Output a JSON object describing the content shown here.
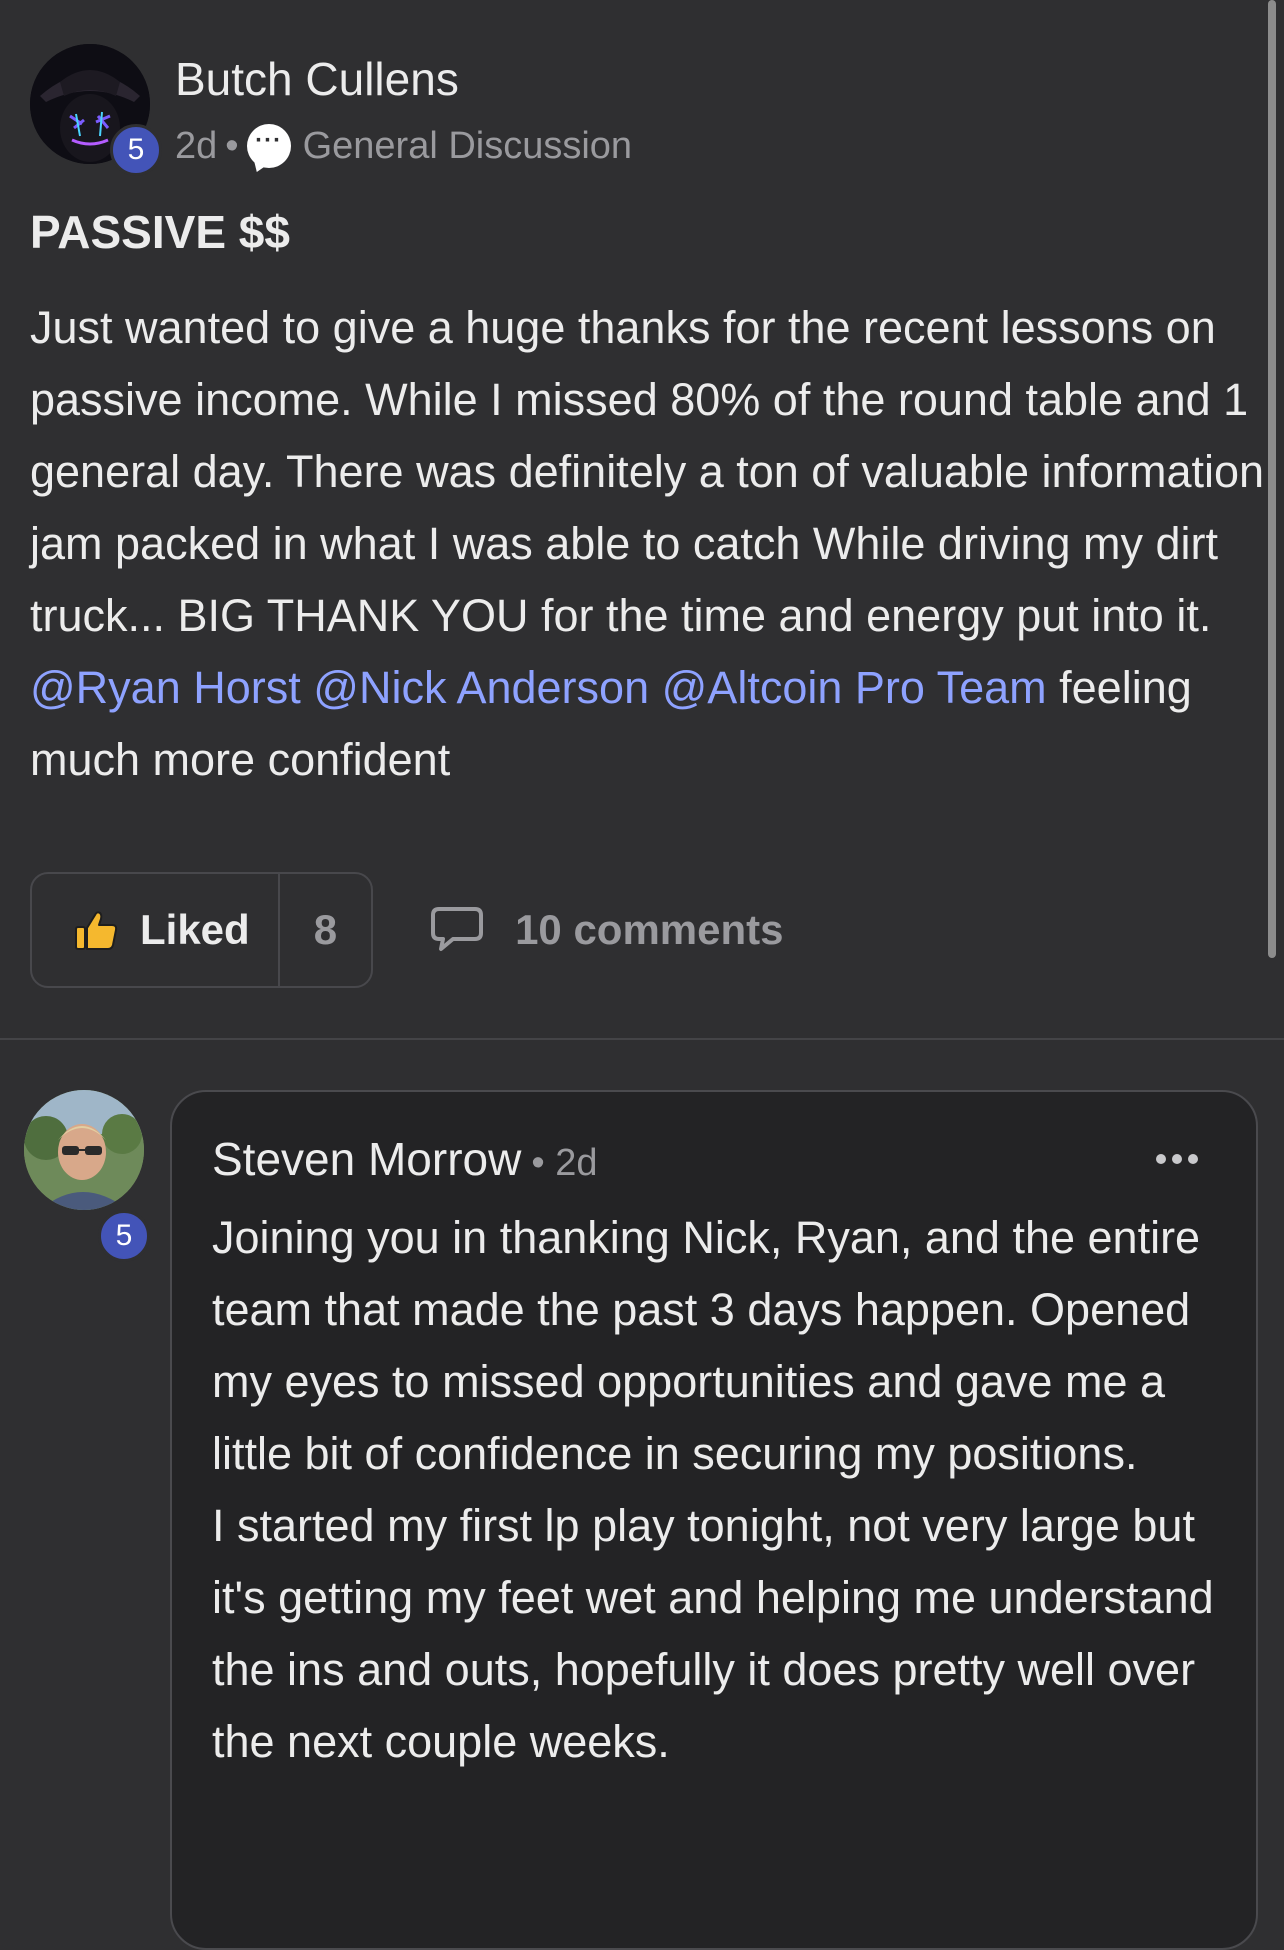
{
  "post": {
    "author": "Butch Cullens",
    "author_level": "5",
    "time_ago": "2d",
    "meta_separator": "•",
    "category": "General Discussion",
    "title": "PASSIVE $$",
    "body_text": "Just wanted to give a huge thanks for the recent lessons on passive income. While I missed 80% of the round table and 1 general day. There was definitely a ton of valuable information jam packed in what I was able to catch While driving my dirt truck... BIG THANK YOU for the time and energy put into it. ",
    "mentions": [
      "@Ryan Horst",
      "@Nick Anderson",
      "@Altcoin Pro Team"
    ],
    "body_tail": " feeling much more confident",
    "like_label": "Liked",
    "like_count": "8",
    "comments_label": "10 comments"
  },
  "comment": {
    "author": "Steven Morrow",
    "author_level": "5",
    "time_ago": "• 2d",
    "body_line1": "Joining you in thanking Nick, Ryan, and the entire team that made the past 3 days happen. Opened my eyes to missed opportunities and gave me a little bit of confidence in securing my positions.",
    "body_line2": "I started my first lp play tonight, not very large but it's getting my feet wet and helping me understand the ins and outs, hopefully it does pretty well over the next couple weeks."
  },
  "colors": {
    "background": "#2f2f31",
    "mention": "#8ea2ff",
    "level_badge": "#4354b8",
    "liked_thumb": "#f5b82e"
  }
}
